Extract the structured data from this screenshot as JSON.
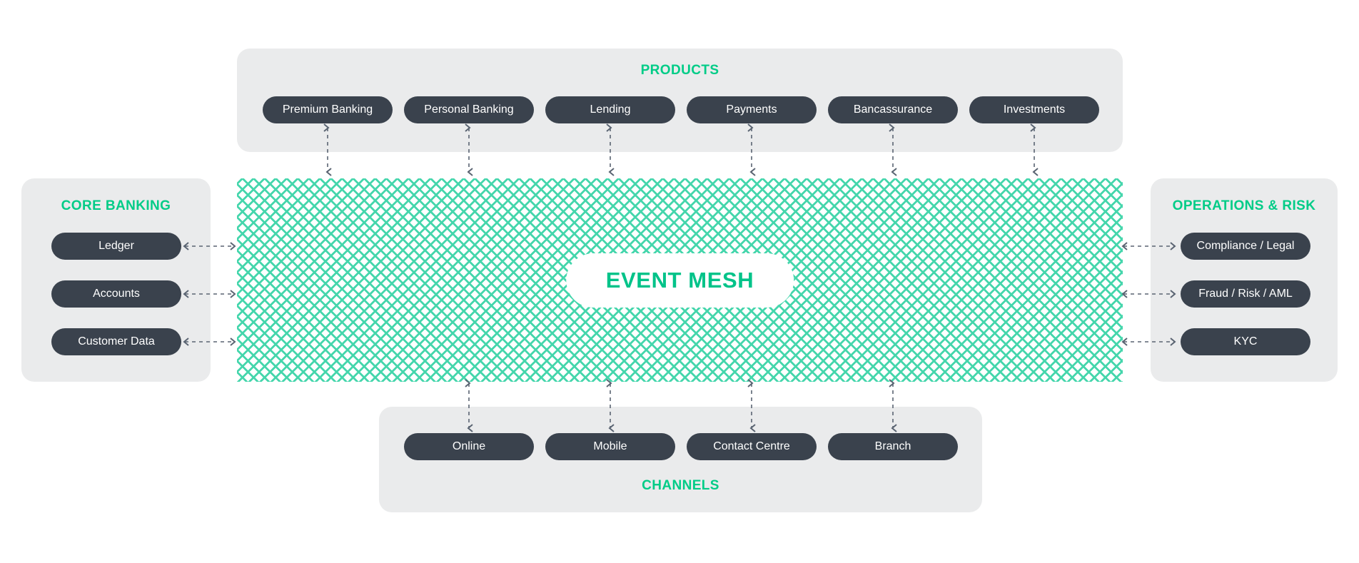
{
  "diagram": {
    "center": {
      "label": "EVENT MESH",
      "pattern": "mesh-lattice",
      "color": "#00c389",
      "mesh_color": "#45d6ac"
    },
    "colors": {
      "panel_bg": "#eaebec",
      "pill_bg": "#3a424d",
      "pill_text": "#ffffff",
      "accent": "#00cc87",
      "connector": "#5a6472",
      "page_bg": "#ffffff"
    },
    "groups": {
      "products": {
        "title": "PRODUCTS",
        "title_position": "top",
        "items": [
          {
            "label": "Premium Banking"
          },
          {
            "label": "Personal Banking"
          },
          {
            "label": "Lending"
          },
          {
            "label": "Payments"
          },
          {
            "label": "Bancassurance"
          },
          {
            "label": "Investments"
          }
        ]
      },
      "core_banking": {
        "title": "CORE BANKING",
        "title_position": "top",
        "items": [
          {
            "label": "Ledger"
          },
          {
            "label": "Accounts"
          },
          {
            "label": "Customer Data"
          }
        ]
      },
      "operations_risk": {
        "title": "OPERATIONS & RISK",
        "title_position": "top",
        "items": [
          {
            "label": "Compliance / Legal"
          },
          {
            "label": "Fraud / Risk / AML"
          },
          {
            "label": "KYC"
          }
        ]
      },
      "channels": {
        "title": "CHANNELS",
        "title_position": "bottom",
        "items": [
          {
            "label": "Online"
          },
          {
            "label": "Mobile"
          },
          {
            "label": "Contact Centre"
          },
          {
            "label": "Branch"
          }
        ]
      }
    },
    "connectors": {
      "style": "dashed",
      "direction": "bidirectional",
      "arrowhead": "open-v"
    }
  }
}
